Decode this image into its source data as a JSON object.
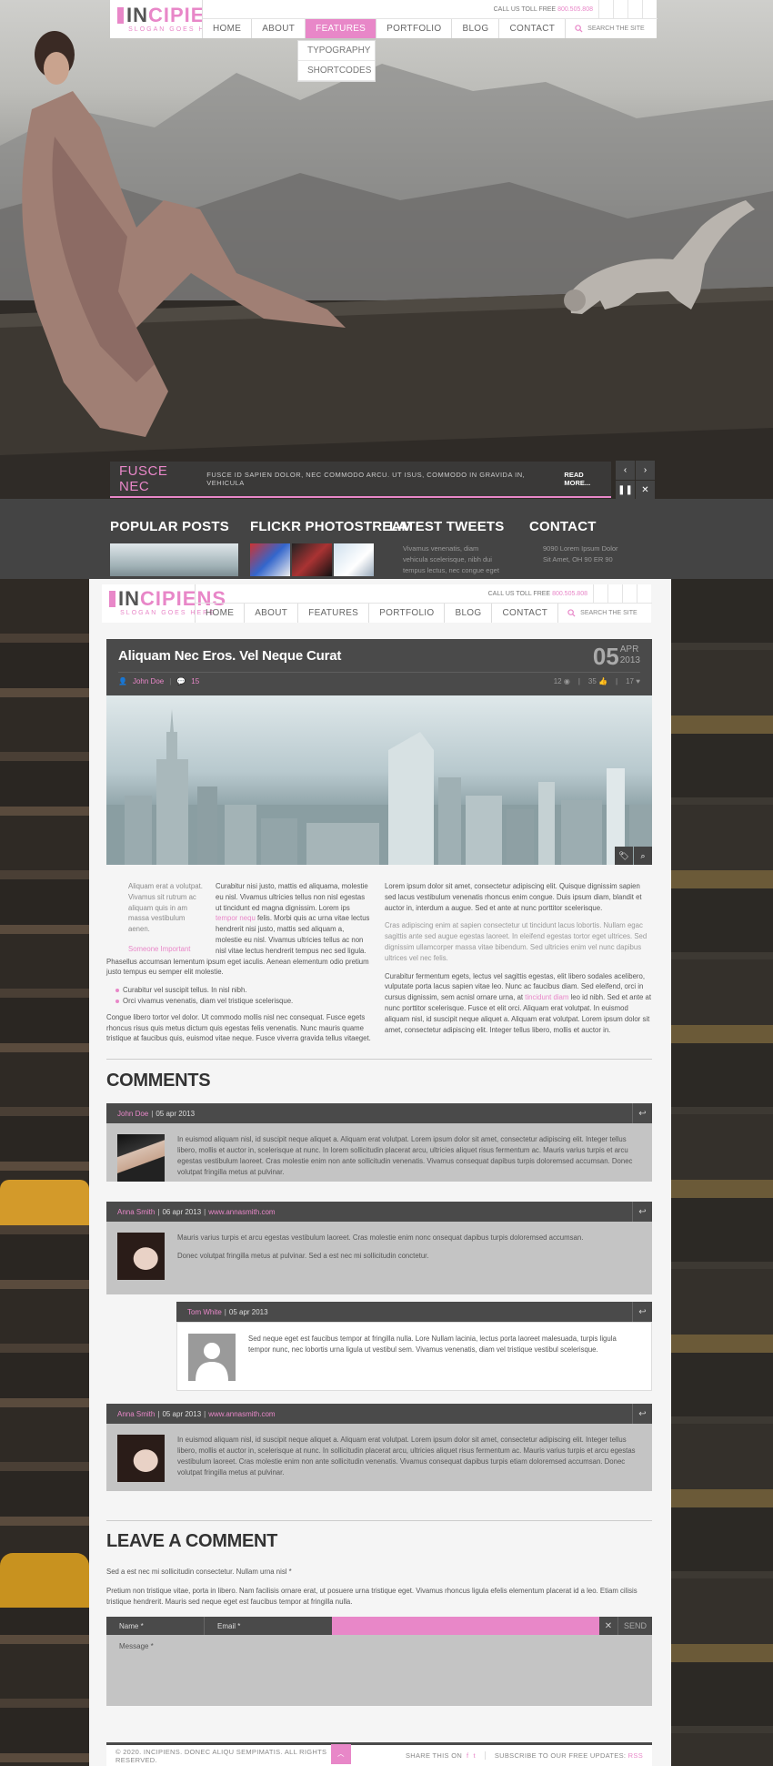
{
  "brand": {
    "name_dark": "IN",
    "name_pink": "CIPIENS",
    "name_pink_alt": "CIPIENS",
    "slogan": "SLOGAN GOES HERE"
  },
  "topbar": {
    "call_label": "CALL US TOLL FREE",
    "phone": "800.505.808"
  },
  "nav": {
    "items": [
      "HOME",
      "ABOUT",
      "FEATURES",
      "PORTFOLIO",
      "BLOG",
      "CONTACT"
    ],
    "search_placeholder": "SEARCH THE SITE",
    "dropdown": [
      "TYPOGRAPHY",
      "SHORTCODES"
    ]
  },
  "slider": {
    "title": "FUSCE NEC",
    "text": "FUSCE ID SAPIEN DOLOR, NEC COMMODO ARCU. UT ISUS, COMMODO IN GRAVIDA IN, VEHICULA",
    "more": "READ MORE..."
  },
  "widgets": {
    "popular": "POPULAR POSTS",
    "flickr": "FLICKR PHOTOSTREAM",
    "tweets": "LATEST TWEETS",
    "tweet_text": [
      "Vivamus venenatis, diam",
      "vehicula scelerisque, nibh dui",
      "tempus lectus, nec congue eget"
    ],
    "contact": "CONTACT",
    "contact_lines": [
      "9090 Lorem Ipsum Dolor",
      "Sit Amet, OH 90 ER 90"
    ]
  },
  "post": {
    "title": "Aliquam Nec Eros. Vel Neque Curat",
    "day": "05",
    "month": "APR",
    "year": "2013",
    "author": "John Doe",
    "comments": "15",
    "stat1": "12",
    "stat2": "35",
    "stat3": "17"
  },
  "body": {
    "quote": "Aliquam erat a volutpat. Vivamus sit rutrum ac aliquam quis in am massa vestibulum aenen.",
    "quote_author": "Someone Important",
    "l1a": "Curabitur nisi justo, mattis ed aliquama, molestie eu nisl. Vivamus ultricies tellus non nisl egestas ut tincidunt ed magna dignissim. Lorem ips",
    "l1link": "tempor nequ",
    "l1b": "felis. Morbi quis ac urna vitae lectus hendrerit nisi justo, mattis sed aliquam a, molestie eu nisl. Vivamus ultricies tellus ac non nisl vitae lectus hendrerit tempus nec sed ligula. Phasellus accumsan lementum ipsum eget iaculis. Aenean elementum odio pretium justo tempus eu semper elit molestie.",
    "bul1": "Curabitur vel suscipit tellus. In nisl nibh.",
    "bul2": "Orci vivamus venenatis, diam vel tristique scelerisque.",
    "l2": "Congue libero tortor vel dolor. Ut commodo mollis nisl nec consequat. Fusce egets rhoncus risus quis metus dictum quis egestas felis venenatis. Nunc mauris quame tristique at faucibus quis, euismod vitae neque. Fusce viverra gravida tellus vitaeget.",
    "r1": "Lorem ipsum dolor sit amet, consectetur adipiscing elit. Quisque dignissim sapien sed lacus vestibulum venenatis rhoncus enim congue. Duis ipsum diam, blandit et auctor in, interdum a augue. Sed et ante at nunc porttitor scelerisque.",
    "r2": "Cras adipiscing enim at sapien consectetur ut tincidunt lacus lobortis. Nullam egac sagittis ante sed augue egestas laoreet. In eleifend egestas tortor eget ultrices. Sed dignissim ullamcorper massa vitae bibendum. Sed ultricies enim vel nunc dapibus ultrices vel nec felis.",
    "r3a": "Curabitur fermentum egets, lectus vel sagittis egestas, elit libero sodales acelibero, vulputate porta lacus sapien vitae leo. Nunc ac faucibus diam. Sed eleifend, orci in cursus dignissim, sem acnisl ornare urna, at",
    "r3link": "tincidunt diam",
    "r3b": "leo id nibh. Sed et ante at nunc porttitor scelerisque. Fusce et elit orci. Aliquam erat volutpat. In euismod aliquam nisl, id suscipit neque aliquet a. Aliquam erat volutpat. Lorem ipsum dolor sit amet, consectetur adipiscing elit. Integer tellus libero, mollis et auctor in."
  },
  "comments": {
    "heading": "COMMENTS",
    "list": [
      {
        "name": "John Doe",
        "date": "05 apr 2013",
        "site": "",
        "text": "In euismod aliquam nisl, id suscipit neque aliquet a. Aliquam erat volutpat. Lorem ipsum dolor sit amet, consectetur adipiscing elit. Integer tellus libero, mollis et auctor in, scelerisque at nunc. In lorem sollicitudin placerat arcu, ultricies aliquet risus fermentum ac. Mauris varius turpis et arcu egestas vestibulum laoreet. Cras molestie enim non ante sollicitudin venenatis. Vivamus consequat dapibus turpis doloremsed accumsan. Donec volutpat fringilla metus at pulvinar."
      },
      {
        "name": "Anna Smith",
        "date": "06 apr 2013",
        "site": "www.annasmith.com",
        "text": "Mauris varius turpis et arcu egestas vestibulum laoreet. Cras molestie enim nonc onsequat dapibus turpis doloremsed accumsan.",
        "text2": "Donec volutpat fringilla metus at pulvinar. Sed a est nec mi sollicitudin conctetur."
      },
      {
        "name": "Tom White",
        "date": "05 apr 2013",
        "site": "",
        "text": "Sed neque eget est faucibus tempor at fringilla nulla. Lore Nullam lacinia, lectus porta laoreet malesuada, turpis ligula tempor nunc, nec lobortis urna ligula ut vestibul sem. Vivamus venenatis, diam vel tristique vestibul scelerisque."
      },
      {
        "name": "Anna Smith",
        "date": "05 apr 2013",
        "site": "www.annasmith.com",
        "text": "In euismod aliquam nisl, id suscipit neque aliquet a. Aliquam erat volutpat. Lorem ipsum dolor sit amet, consectetur adipiscing elit. Integer tellus libero, mollis et auctor in, scelerisque at nunc. In sollicitudin placerat arcu, ultricies aliquet risus fermentum ac. Mauris varius turpis et arcu egestas vestibulum laoreet. Cras molestie enim non ante sollicitudin venenatis. Vivamus consequat dapibus turpis etiam doloremsed accumsan. Donec volutpat fringilla metus at pulvinar."
      }
    ]
  },
  "leave": {
    "heading": "LEAVE A COMMENT",
    "note": "Sed a est nec mi sollicitudin consectetur. Nullam urna nisl *",
    "para": "Pretium non tristique vitae, porta in libero. Nam facilisis ornare erat, ut posuere urna tristique eget. Vivamus rhoncus ligula efelis elementum placerat id a leo. Etiam cilisis tristique hendrerit. Mauris sed neque eget est faucibus tempor at fringilla nulla.",
    "name_label": "Name *",
    "email_label": "Email *",
    "send": "SEND",
    "message_label": "Message *"
  },
  "footer": {
    "copy": "© 2020. INCIPIENS. DONEC ALIQU SEMPIMATIS. ALL RIGHTS RESERVED.",
    "share": "SHARE THIS ON",
    "subscribe": "SUBSCRIBE TO OUR FREE UPDATES:",
    "rss": "RSS"
  },
  "colors": {
    "accent": "#e887c8",
    "dark": "#4a4a4a",
    "panel": "#c4c4c4"
  }
}
